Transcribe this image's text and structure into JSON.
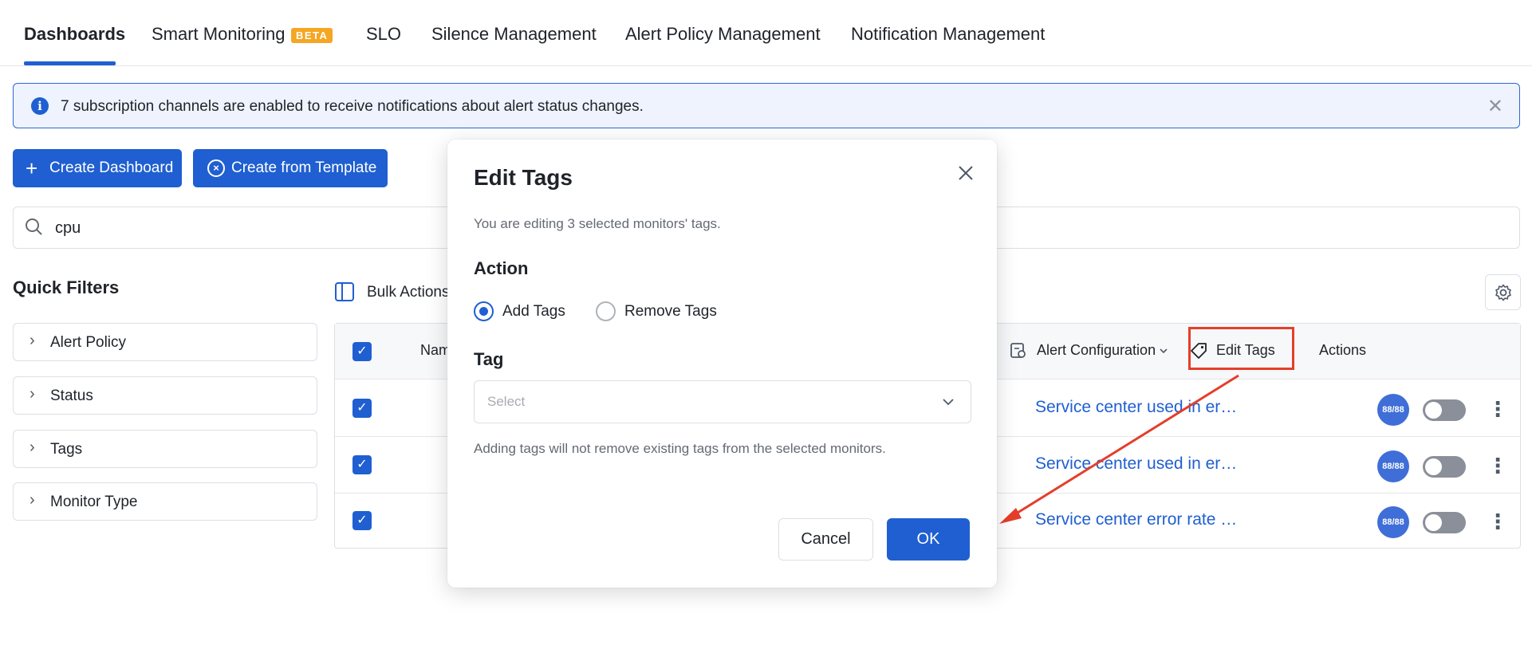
{
  "tabs": [
    {
      "label": "Dashboards",
      "active": true
    },
    {
      "label": "Smart Monitoring",
      "badge": "BETA"
    },
    {
      "label": "SLO"
    },
    {
      "label": "Silence Management"
    },
    {
      "label": "Alert Policy Management"
    },
    {
      "label": "Notification Management"
    }
  ],
  "banner": {
    "text": "7 subscription channels are enabled to receive notifications about alert status changes.",
    "close": "✕"
  },
  "toolbar": {
    "create_dashboard": "Create Dashboard",
    "create_from_template": "Create from Template"
  },
  "search": {
    "value": "cpu"
  },
  "quick_filters": {
    "title": "Quick Filters",
    "items": [
      "Alert Policy",
      "Status",
      "Tags",
      "Monitor Type"
    ]
  },
  "bulk_actions": {
    "label": "Bulk Actions"
  },
  "table": {
    "headers": {
      "name": "Nam",
      "alert_configuration": "Alert Configuration",
      "edit_tags": "Edit Tags",
      "actions": "Actions"
    },
    "rows": [
      {
        "alert_config": "Service center used in er…",
        "badge": "88/88"
      },
      {
        "alert_config": "Service center used in er…",
        "badge": "88/88"
      },
      {
        "alert_config": "Service center error rate …",
        "badge": "88/88"
      }
    ]
  },
  "modal": {
    "title": "Edit Tags",
    "subtitle": "You are editing 3 selected monitors' tags.",
    "action_label": "Action",
    "radio_add": "Add Tags",
    "radio_remove": "Remove Tags",
    "selected_action": "Add Tags",
    "tag_label": "Tag",
    "select_placeholder": "Select",
    "hint": "Adding tags will not remove existing tags from the selected monitors.",
    "cancel": "Cancel",
    "ok": "OK"
  },
  "colors": {
    "primary": "#1f5fd1",
    "annotation": "#e53e2a",
    "beta": "#f5a623"
  }
}
